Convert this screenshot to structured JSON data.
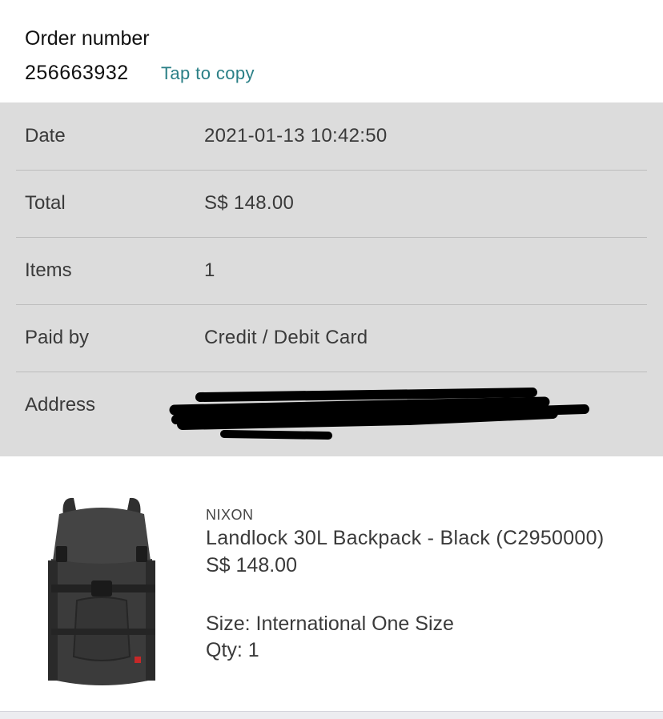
{
  "order": {
    "label": "Order number",
    "number": "256663932",
    "copy_label": "Tap to copy"
  },
  "details": [
    {
      "key": "Date",
      "value": "2021-01-13 10:42:50"
    },
    {
      "key": "Total",
      "value": "S$ 148.00"
    },
    {
      "key": "Items",
      "value": "1"
    },
    {
      "key": "Paid by",
      "value": "Credit / Debit Card"
    },
    {
      "key": "Address",
      "value": ""
    }
  ],
  "product": {
    "brand": "NIXON",
    "name": "Landlock 30L Backpack - Black (C2950000)",
    "price": "S$ 148.00",
    "size": "Size: International One Size",
    "qty": "Qty: 1",
    "image_icon": "backpack-image"
  },
  "colors": {
    "accent": "#2a7f86",
    "panel_bg": "#dcdcdc",
    "text": "#3a3a3a"
  }
}
